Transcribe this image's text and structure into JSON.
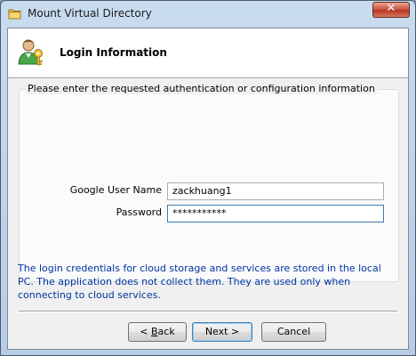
{
  "window": {
    "title": "Mount Virtual Directory",
    "close_label": "✕"
  },
  "header": {
    "title": "Login Information"
  },
  "group": {
    "legend": "Please enter the requested authentication or configuration information"
  },
  "form": {
    "username_label": "Google User Name",
    "username_value": "zackhuang1",
    "password_label": "Password",
    "password_value": "***********"
  },
  "note": {
    "text": "The login credentials for cloud storage and services are stored in the local PC. The application does not collect them. They are used only when connecting to cloud services."
  },
  "buttons": {
    "back_prefix": "< ",
    "back_accel": "B",
    "back_rest": "ack",
    "next": "Next >",
    "cancel": "Cancel"
  },
  "icons": {
    "title": "folder-icon",
    "header": "user-key-icon"
  },
  "colors": {
    "note_text": "#0033a0",
    "close_button": "#c9503a"
  }
}
